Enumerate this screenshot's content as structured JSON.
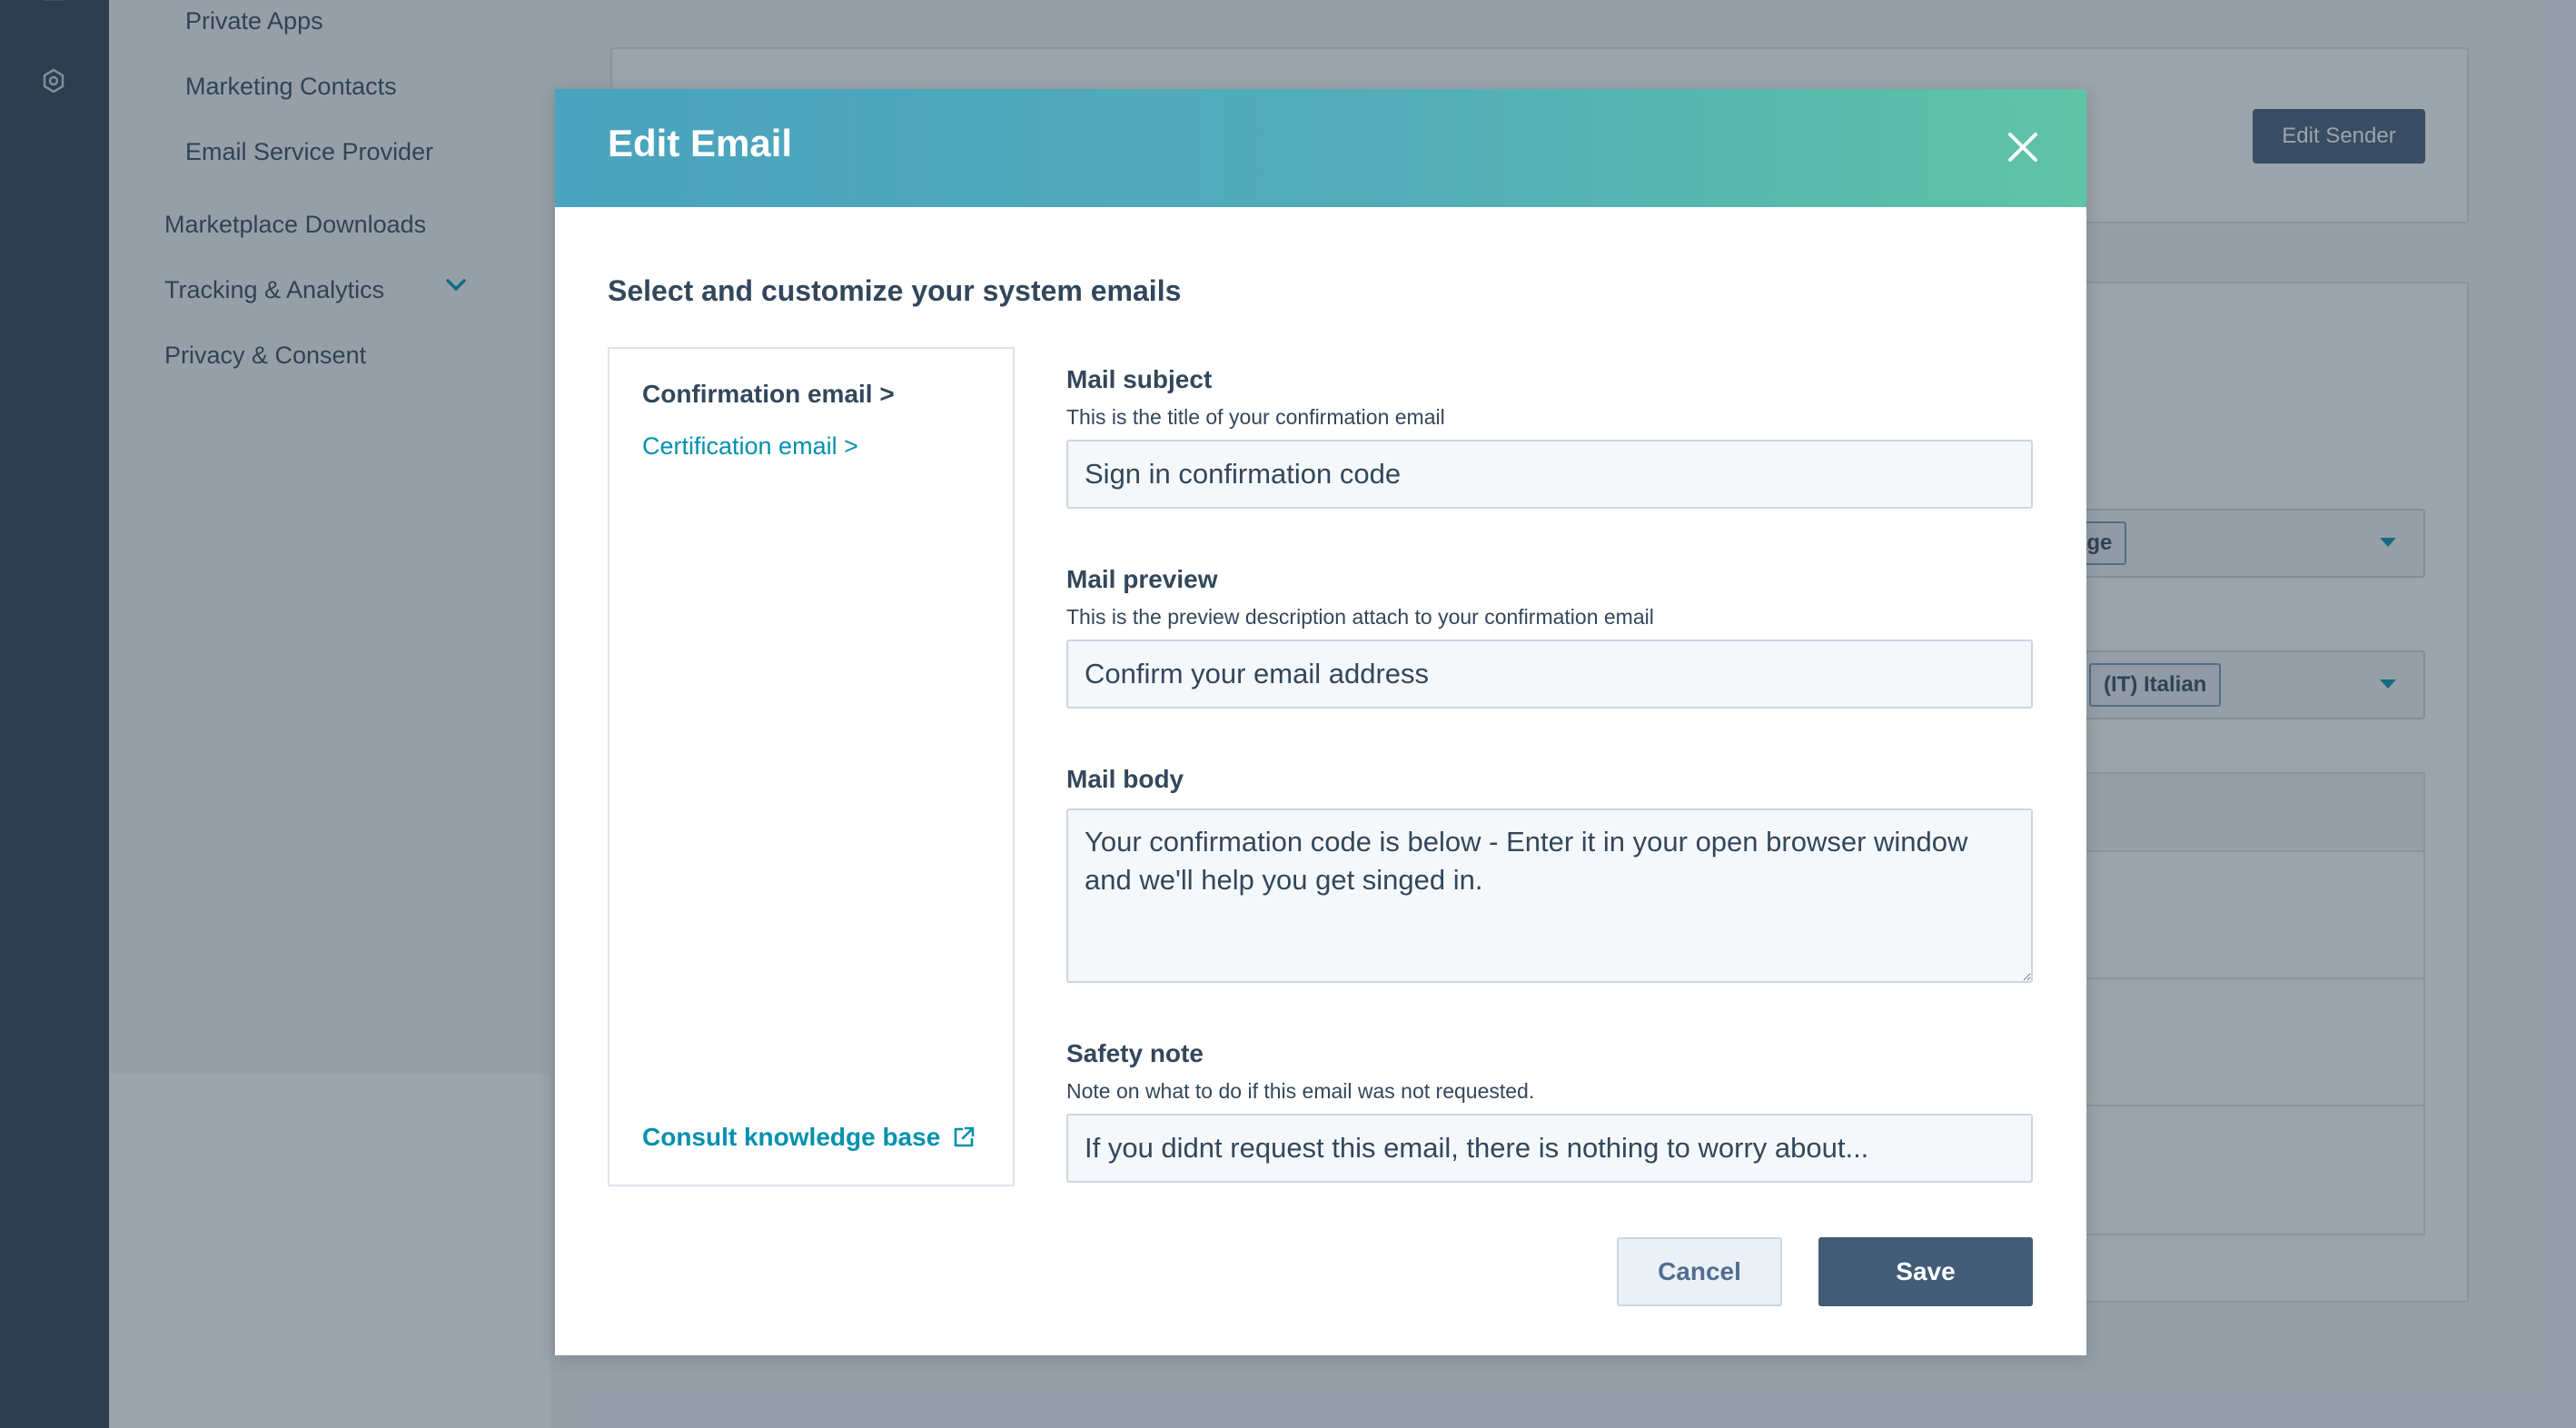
{
  "sidebar": {
    "items": [
      {
        "label": "Private Apps"
      },
      {
        "label": "Marketing Contacts"
      },
      {
        "label": "Email Service Provider"
      },
      {
        "label": "Marketplace Downloads"
      },
      {
        "label": "Tracking & Analytics"
      },
      {
        "label": "Privacy & Consent"
      }
    ]
  },
  "background": {
    "edit_sender_label": "Edit Sender",
    "select_1_value": "age",
    "select_2_value": "(IT) Italian"
  },
  "modal": {
    "title": "Edit Email",
    "section_title": "Select and customize your system emails",
    "email_types": {
      "active": "Confirmation email >",
      "other": "Certification email >"
    },
    "knowledge_base_link": "Consult knowledge base",
    "fields": {
      "subject": {
        "label": "Mail subject",
        "help": "This is the title of your confirmation email",
        "value": "Sign in confirmation code"
      },
      "preview": {
        "label": "Mail preview",
        "help": "This is the preview description attach to your confirmation email",
        "value": "Confirm your email address"
      },
      "body": {
        "label": "Mail body",
        "value": "Your confirmation code is below - Enter it in your open browser window and we'll help you get singed in."
      },
      "safety": {
        "label": "Safety note",
        "help": "Note on what to do if this email was not requested.",
        "value": "If you didnt request this email, there is nothing to worry about..."
      }
    },
    "cancel_label": "Cancel",
    "save_label": "Save"
  },
  "colors": {
    "header_gradient_start": "#4aa3bf",
    "header_gradient_end": "#5ec4a5",
    "link": "#0091ae",
    "primary_button": "#425b76",
    "text": "#33475b"
  }
}
